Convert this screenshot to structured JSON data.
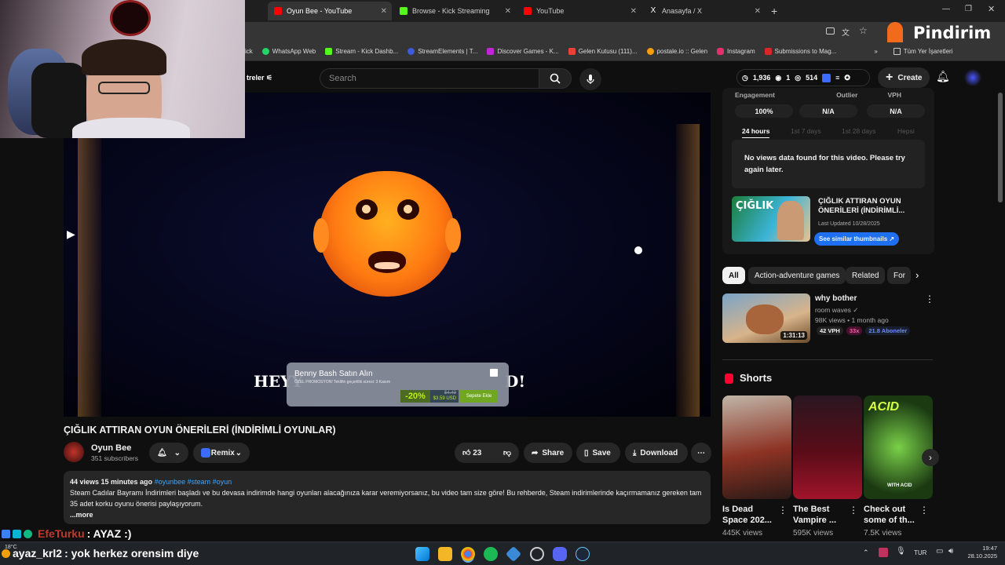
{
  "tabs": [
    {
      "label": "Oyun Bee - YouTube",
      "color": "#ff0000"
    },
    {
      "label": "Browse - Kick Streaming",
      "color": "#53fc18"
    },
    {
      "label": "YouTube",
      "color": "#ff0000"
    },
    {
      "label": "Anasayfa / X",
      "color": "#ffffff"
    }
  ],
  "new_tab": "+",
  "bookmarks": [
    {
      "label": "ick",
      "color": "#53fc18"
    },
    {
      "label": "WhatsApp Web",
      "color": "#25d366"
    },
    {
      "label": "Stream - Kick Dashb...",
      "color": "#53fc18"
    },
    {
      "label": "StreamElements | T...",
      "color": "#3b5bdb"
    },
    {
      "label": "Discover Games - K...",
      "color": "#c026d3"
    },
    {
      "label": "Gelen Kutusu (111)...",
      "color": "#ea4335"
    },
    {
      "label": "postale.io :: Gelen",
      "color": "#f59e0b"
    },
    {
      "label": "Instagram",
      "color": "#e1306c"
    },
    {
      "label": "Submissions to Mag...",
      "color": "#dc2626"
    }
  ],
  "bookmarks_more": "»",
  "all_bookmarks": "Tüm Yer İşaretleri",
  "brand": "Pindirim",
  "header": {
    "filters_label": "treler",
    "search_placeholder": "Search",
    "stats": [
      "1,936",
      "1",
      "514"
    ],
    "create_label": "Create"
  },
  "player": {
    "caption_left": "HEYY",
    "caption_right": "D!",
    "overlay": {
      "title": "Benny Bash Satın Alın",
      "subtitle": "ÖZEL PROMOSYON! Teklifin geçerlilik süresi: 3 Kasım",
      "discount": "-20%",
      "old_price": "$4.49",
      "price": "$3.59 USD",
      "cta": "Sepete Ekle"
    }
  },
  "video": {
    "title": "ÇIĞLIK ATTIRAN OYUN ÖNERİLERİ (İNDİRİMLİ OYUNLAR)",
    "channel": "Oyun Bee",
    "subscribers": "351 subscribers",
    "remix_label": "Remix",
    "likes": "23",
    "share_label": "Share",
    "save_label": "Save",
    "download_label": "Download",
    "views_line": "44 views  15 minutes ago",
    "hashtags": "#oyunbee #steam #oyun",
    "description": "Steam Cadılar Bayramı İndirimleri başladı ve bu devasa indirimde hangi oyunları alacağınıza karar veremiyorsanız, bu video tam size göre! Bu rehberde, Steam indirimlerinde kaçırmamanız gereken tam 35 adet korku oyunu önerisi paylaşıyorum.",
    "more_label": "...more"
  },
  "analytics": {
    "headers": [
      "Engagement",
      "Outlier",
      "VPH"
    ],
    "values": [
      "100%",
      "N/A",
      "N/A"
    ],
    "time_tabs": [
      "24 hours",
      "1st 7 days",
      "1st 28 days",
      "Hepsi"
    ],
    "no_data": "No views data found for this video. Please try again later.",
    "thumb_title": "ÇIĞLIK ATTIRAN OYUN ÖNERİLERİ (İNDİRİMLİ...",
    "thumb_updated": "Last Updated 10/28/2025",
    "similar_button": "See similar thumbnails ↗",
    "thumb_overlay": "ÇIĞLIK"
  },
  "chips": [
    "All",
    "Action-adventure games",
    "Related",
    "For"
  ],
  "recommended": {
    "title": "why bother",
    "channel": "room waves",
    "meta": "98K views • 1 month ago",
    "duration": "1:31:13",
    "vph": "42 VPH",
    "outlier": "33x",
    "subs": "21.8 Aboneler"
  },
  "shorts": {
    "heading": "Shorts",
    "items": [
      {
        "title": "Is Dead Space 202...",
        "views": "445K views"
      },
      {
        "title": "The Best Vampire ...",
        "views": "595K views"
      },
      {
        "title": "Check out some of th...",
        "views": "7.5K views"
      }
    ],
    "acid_text": "ACID",
    "acid_badge": "WITH ACID"
  },
  "chat": [
    {
      "user": "EfeTurku",
      "message": ": AYAZ :)"
    },
    {
      "user": "ayaz_krl2",
      "message": ": yok herkez orensim diye"
    }
  ],
  "taskbar": {
    "weather": "18°C",
    "lang": "TUR",
    "time": "19:47",
    "date": "28.10.2025"
  }
}
